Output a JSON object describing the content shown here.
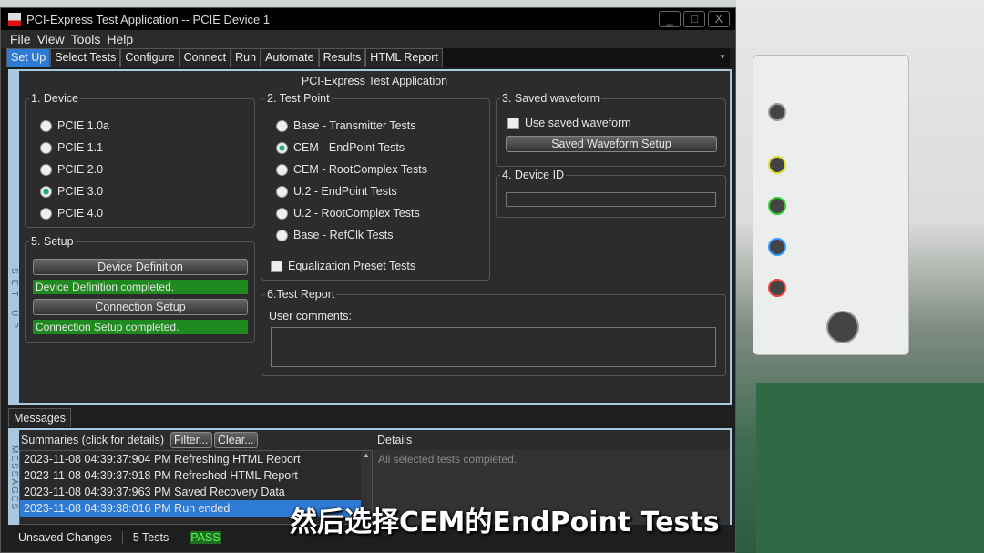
{
  "window": {
    "title": "PCI-Express Test Application -- PCIE Device 1",
    "min": "_",
    "max": "□",
    "close": "X"
  },
  "menu": [
    "File",
    "View",
    "Tools",
    "Help"
  ],
  "tabs": [
    "Set Up",
    "Select Tests",
    "Configure",
    "Connect",
    "Run",
    "Automate",
    "Results",
    "HTML Report"
  ],
  "side_label": "SET UP",
  "panel_title": "PCI-Express Test Application",
  "device": {
    "label": "1. Device",
    "options": [
      "PCIE 1.0a",
      "PCIE 1.1",
      "PCIE 2.0",
      "PCIE 3.0",
      "PCIE 4.0"
    ],
    "selected": "PCIE 3.0"
  },
  "test_point": {
    "label": "2. Test Point",
    "options": [
      "Base - Transmitter Tests",
      "CEM - EndPoint Tests",
      "CEM - RootComplex Tests",
      "U.2 - EndPoint Tests",
      "U.2 - RootComplex Tests",
      "Base - RefClk Tests"
    ],
    "selected": "CEM - EndPoint Tests",
    "equalization": "Equalization Preset Tests",
    "equalization_checked": false
  },
  "saved_waveform": {
    "label": "3. Saved waveform",
    "use": "Use saved waveform",
    "use_checked": false,
    "setup_button": "Saved Waveform Setup"
  },
  "device_id": {
    "label": "4. Device ID",
    "value": ""
  },
  "setup": {
    "label": "5. Setup",
    "device_def_button": "Device Definition",
    "device_def_status": "Device Definition completed.",
    "connection_button": "Connection Setup",
    "connection_status": "Connection Setup completed."
  },
  "test_report": {
    "label": "6.Test Report",
    "comments_label": "User comments:",
    "comments": ""
  },
  "messages": {
    "tab": "Messages",
    "side_label": "MESSAGES",
    "summaries": "Summaries (click for details)",
    "filter": "Filter...",
    "clear": "Clear...",
    "details_label": "Details",
    "details": "All selected tests completed.",
    "rows": [
      "2023-11-08 04:39:37:904 PM Refreshing HTML Report",
      "2023-11-08 04:39:37:918 PM Refreshed HTML Report",
      "2023-11-08 04:39:37:963 PM Saved Recovery Data",
      "2023-11-08 04:39:38:016 PM Run ended"
    ],
    "selected_row": 3
  },
  "status": {
    "changes": "Unsaved Changes",
    "tests": "5 Tests",
    "result": "PASS"
  },
  "subtitle": "然后选择CEM的EndPoint Tests",
  "colors": {
    "accent": "#2e7bd6",
    "success": "#1f8a1f"
  }
}
